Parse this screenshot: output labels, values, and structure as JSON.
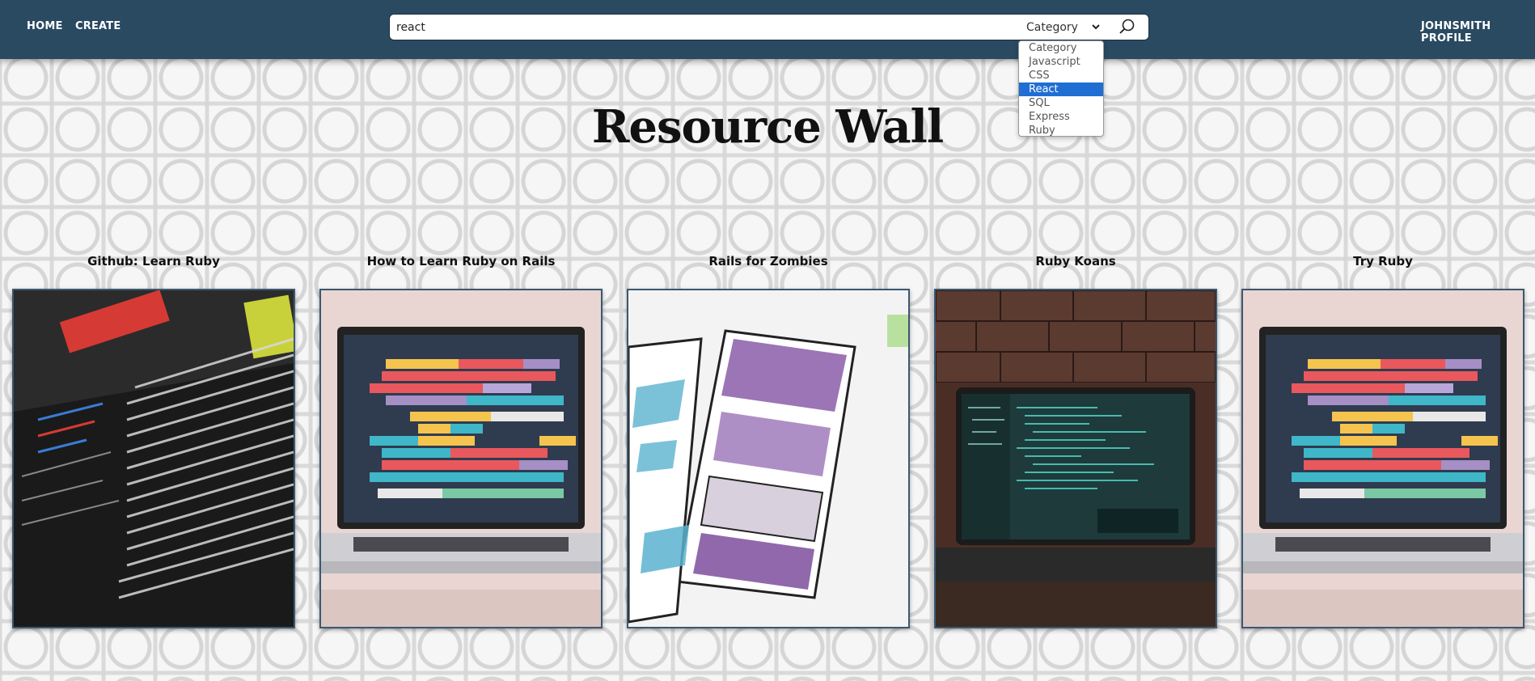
{
  "nav": {
    "home_label": "HOME",
    "create_label": "CREATE",
    "profile_label": "JOHNSMITH PROFILE"
  },
  "search": {
    "value": "react",
    "category_selected": "Category",
    "search_icon": "magnifier-icon",
    "chevron_icon": "chevron-down-icon",
    "options": [
      "Category",
      "Javascript",
      "CSS",
      "React",
      "SQL",
      "Express",
      "Ruby"
    ],
    "highlighted_option": "React"
  },
  "page": {
    "title": "Resource Wall"
  },
  "cards": [
    {
      "title": "Github: Learn Ruby",
      "image": "terminal-screen-photo"
    },
    {
      "title": "How to Learn Ruby on Rails",
      "image": "laptop-gantt-photo"
    },
    {
      "title": "Rails for Zombies",
      "image": "wireframe-sketch-photo"
    },
    {
      "title": "Ruby Koans",
      "image": "laptop-code-brick-photo"
    },
    {
      "title": "Try Ruby",
      "image": "laptop-gantt-photo"
    }
  ],
  "colors": {
    "navbar": "#2a4a62",
    "dropdown_highlight": "#1f6ed4"
  }
}
